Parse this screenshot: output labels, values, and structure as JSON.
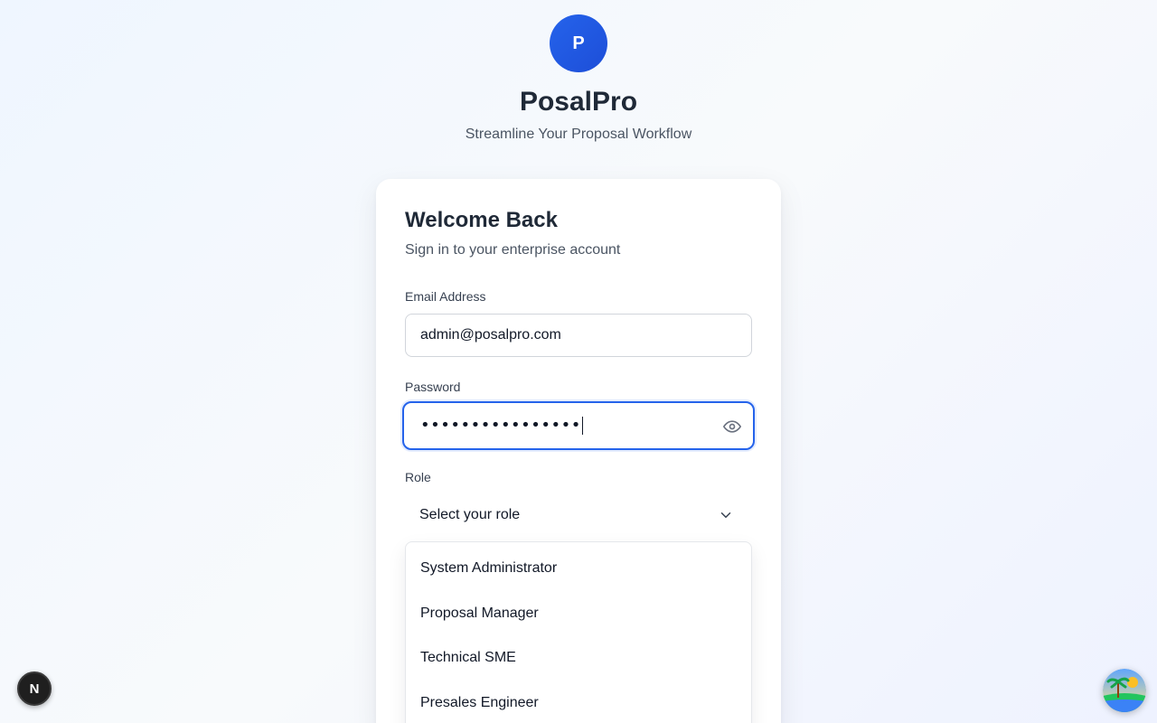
{
  "brand": {
    "logo_letter": "P",
    "title": "PosalPro",
    "tagline": "Streamline Your Proposal Workflow"
  },
  "login": {
    "title": "Welcome Back",
    "subtitle": "Sign in to your enterprise account",
    "email_label": "Email Address",
    "email_value": "admin@posalpro.com",
    "password_label": "Password",
    "password_masked": "••••••••••••••••",
    "role_label": "Role",
    "role_placeholder": "Select your role"
  },
  "role_options": [
    "System Administrator",
    "Proposal Manager",
    "Technical SME",
    "Presales Engineer"
  ],
  "icons": {
    "eye": "eye-icon",
    "chevron": "chevron-down-icon"
  },
  "overlay": {
    "n_badge_letter": "N"
  },
  "colors": {
    "accent": "#2563eb",
    "text": "#1f2937",
    "muted": "#4b5563"
  }
}
